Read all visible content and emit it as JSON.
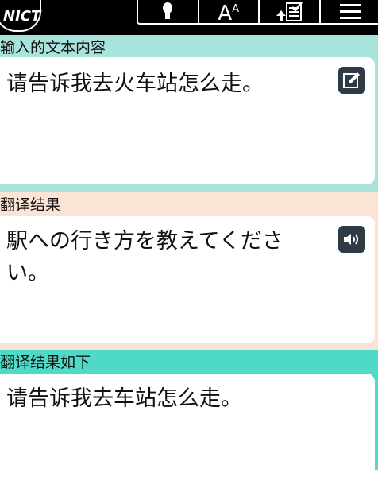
{
  "header": {
    "logo_text": "NICT",
    "tools": [
      {
        "icon": "lightbulb-icon"
      },
      {
        "icon": "font-size-icon",
        "label": "A",
        "sup": "A"
      },
      {
        "icon": "history-icon"
      },
      {
        "icon": "menu-icon"
      }
    ]
  },
  "sections": [
    {
      "label": "输入的文本内容",
      "text": "请告诉我去火车站怎么走。",
      "icon": "edit-icon",
      "bg": "#a9e4dc"
    },
    {
      "label": "翻译结果",
      "text": "駅への行き方を教えてください。",
      "icon": "speaker-icon",
      "bg": "#fbe3d6"
    },
    {
      "label": "翻译结果如下",
      "text": "请告诉我去车站怎么走。",
      "bg": "#4fd9c7"
    }
  ],
  "colors": {
    "header_bg": "#000000",
    "icon_bg": "#2e3a46",
    "section1_bg": "#a9e4dc",
    "section2_bg": "#fbe3d6",
    "section3_bg": "#4fd9c7"
  }
}
